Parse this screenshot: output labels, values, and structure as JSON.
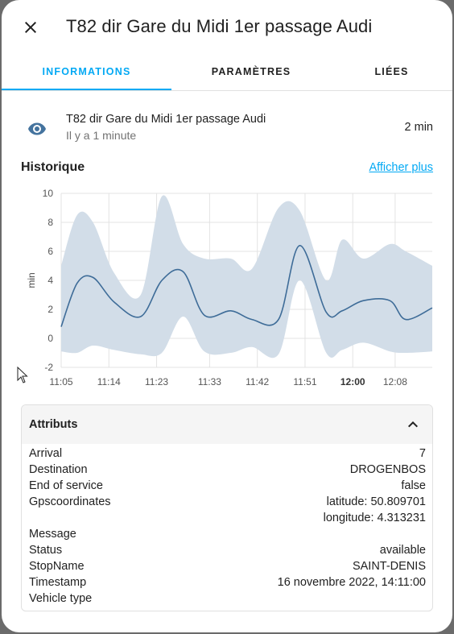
{
  "dialog": {
    "title": "T82 dir Gare du Midi 1er passage Audi",
    "close_icon": "close-icon"
  },
  "tabs": [
    {
      "label": "INFORMATIONS",
      "active": true
    },
    {
      "label": "PARAMÈTRES",
      "active": false
    },
    {
      "label": "LIÉES",
      "active": false
    }
  ],
  "entity": {
    "icon": "eye-icon",
    "name": "T82 dir Gare du Midi 1er passage Audi",
    "last_changed": "Il y a 1 minute",
    "state": "2 min"
  },
  "history": {
    "title": "Historique",
    "more_link": "Afficher plus"
  },
  "chart_data": {
    "type": "line",
    "ylabel": "min",
    "ylim": [
      -2,
      10
    ],
    "yticks": [
      "10",
      "8",
      "6",
      "4",
      "2",
      "0",
      "-2"
    ],
    "xticks": [
      {
        "label": "11:05",
        "t": 0,
        "bold": false
      },
      {
        "label": "11:14",
        "t": 9,
        "bold": false
      },
      {
        "label": "11:23",
        "t": 18,
        "bold": false
      },
      {
        "label": "11:33",
        "t": 28,
        "bold": false
      },
      {
        "label": "11:42",
        "t": 37,
        "bold": false
      },
      {
        "label": "11:51",
        "t": 46,
        "bold": false
      },
      {
        "label": "12:00",
        "t": 55,
        "bold": true
      },
      {
        "label": "12:08",
        "t": 63,
        "bold": false
      }
    ],
    "x_minutes": [
      0,
      3,
      6,
      10,
      15,
      19,
      23,
      27,
      32,
      36,
      41,
      45,
      50,
      53,
      57,
      62,
      65,
      70
    ],
    "mean": [
      0.8,
      3.8,
      4.2,
      2.5,
      1.5,
      4.0,
      4.6,
      1.6,
      1.9,
      1.3,
      1.3,
      6.4,
      1.8,
      1.9,
      2.6,
      2.6,
      1.3,
      2.1
    ],
    "max": [
      5.0,
      8.5,
      8.0,
      4.5,
      3.0,
      9.8,
      6.5,
      5.5,
      5.5,
      4.8,
      9.0,
      8.8,
      4.0,
      6.8,
      5.5,
      6.5,
      6.0,
      5.0
    ],
    "min": [
      -0.9,
      -1.0,
      -0.5,
      -0.8,
      -1.1,
      -1.0,
      1.5,
      -0.9,
      -1.0,
      -0.6,
      -1.1,
      4.0,
      -1.0,
      -0.8,
      -0.3,
      -0.9,
      -1.0,
      -0.9
    ],
    "x_range": [
      0,
      70
    ],
    "line_color": "#3e6c98",
    "band_color": "#d2dde8",
    "grid": true
  },
  "attributes": {
    "title": "Attributs",
    "toggle_icon": "chevron-up-icon",
    "rows": [
      {
        "key": "Arrival",
        "values": [
          "7"
        ]
      },
      {
        "key": "Destination",
        "values": [
          "DROGENBOS"
        ]
      },
      {
        "key": "End of service",
        "values": [
          "false"
        ]
      },
      {
        "key": "Gpscoordinates",
        "values": [
          "latitude: 50.809701",
          "longitude: 4.313231"
        ]
      },
      {
        "key": "Message",
        "values": [
          ""
        ]
      },
      {
        "key": "Status",
        "values": [
          "available"
        ]
      },
      {
        "key": "StopName",
        "values": [
          "SAINT-DENIS"
        ]
      },
      {
        "key": "Timestamp",
        "values": [
          "16 novembre 2022, 14:11:00"
        ]
      },
      {
        "key": "Vehicle type",
        "values": [
          ""
        ]
      }
    ]
  },
  "colors": {
    "accent": "#03a9f4",
    "icon": "#44739e"
  }
}
